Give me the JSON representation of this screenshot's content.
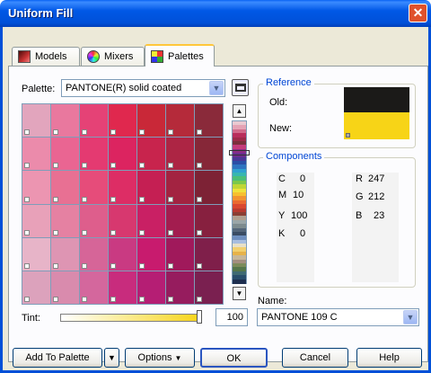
{
  "window": {
    "title": "Uniform Fill",
    "close_glyph": "✕"
  },
  "tabs": [
    {
      "label": "Models",
      "icon": "models-icon",
      "active": false
    },
    {
      "label": "Mixers",
      "icon": "mixers-icon",
      "active": false
    },
    {
      "label": "Palettes",
      "icon": "palettes-icon",
      "active": true
    }
  ],
  "palette": {
    "label": "Palette:",
    "selected": "PANTONE(R) solid coated",
    "swatch_rows": [
      [
        "#e2a5bd",
        "#e9789e",
        "#e54276",
        "#e0284e",
        "#c92838",
        "#b52a3a",
        "#8a2a3a"
      ],
      [
        "#eb8bab",
        "#ea6592",
        "#e43a71",
        "#dc2460",
        "#c8244d",
        "#ad2544",
        "#862738"
      ],
      [
        "#ec95b1",
        "#e87093",
        "#e64c7a",
        "#dd2d65",
        "#c51f53",
        "#a32341",
        "#7d2235"
      ],
      [
        "#e8a1b9",
        "#e581a2",
        "#de5e8c",
        "#d7386f",
        "#c92064",
        "#a31d4f",
        "#87203f"
      ],
      [
        "#e7b4c8",
        "#de95b3",
        "#d66598",
        "#c93a82",
        "#c81b6e",
        "#a0195b",
        "#7f1f4a"
      ],
      [
        "#dca2bc",
        "#d98bad",
        "#d4679d",
        "#c82c7d",
        "#b51e74",
        "#961c5e",
        "#7a2050"
      ]
    ],
    "strip_colors": [
      "#e9c9d1",
      "#e5a3b5",
      "#d16a8b",
      "#b82e5c",
      "#9e2a4a",
      "#7b2f3d",
      "#c43b7c",
      "#8e2c86",
      "#6b2e8f",
      "#4b3796",
      "#2b4ea6",
      "#2f74c0",
      "#2fa0d0",
      "#37b6b0",
      "#4bbf77",
      "#7cc84b",
      "#c0d636",
      "#efe23b",
      "#f6c02f",
      "#f29430",
      "#ea6a30",
      "#d9472f",
      "#b83a30",
      "#8a3f34",
      "#b0a090",
      "#9aa6a8",
      "#7d8b8f",
      "#54667a",
      "#3a4c63",
      "#6e8fbf",
      "#a7bde0",
      "#e8e0c8",
      "#f2d06f",
      "#e6b24a",
      "#c7b79a",
      "#a38f7f",
      "#7c8b5a",
      "#55764a",
      "#3f6b73",
      "#294e6b",
      "#1d2e4f"
    ]
  },
  "tint": {
    "label": "Tint:",
    "value": "100",
    "fraction": 1.0
  },
  "reference": {
    "title": "Reference",
    "old_label": "Old:",
    "new_label": "New:",
    "old_color": "#1b1a18",
    "new_color": "#f7d417"
  },
  "components": {
    "title": "Components",
    "cmyk": [
      {
        "key": "C",
        "value": "0"
      },
      {
        "key": "M",
        "value": "10"
      },
      {
        "key": "Y",
        "value": "100"
      },
      {
        "key": "K",
        "value": "0"
      }
    ],
    "rgb": [
      {
        "key": "R",
        "value": "247"
      },
      {
        "key": "G",
        "value": "212"
      },
      {
        "key": "B",
        "value": "23"
      }
    ]
  },
  "name_field": {
    "label": "Name:",
    "value": "PANTONE 109 C"
  },
  "buttons": {
    "add_to_palette": "Add To Palette",
    "options": "Options",
    "ok": "OK",
    "cancel": "Cancel",
    "help": "Help"
  },
  "colors": {
    "accent": "#0050d8",
    "group_title": "#0046d5"
  }
}
